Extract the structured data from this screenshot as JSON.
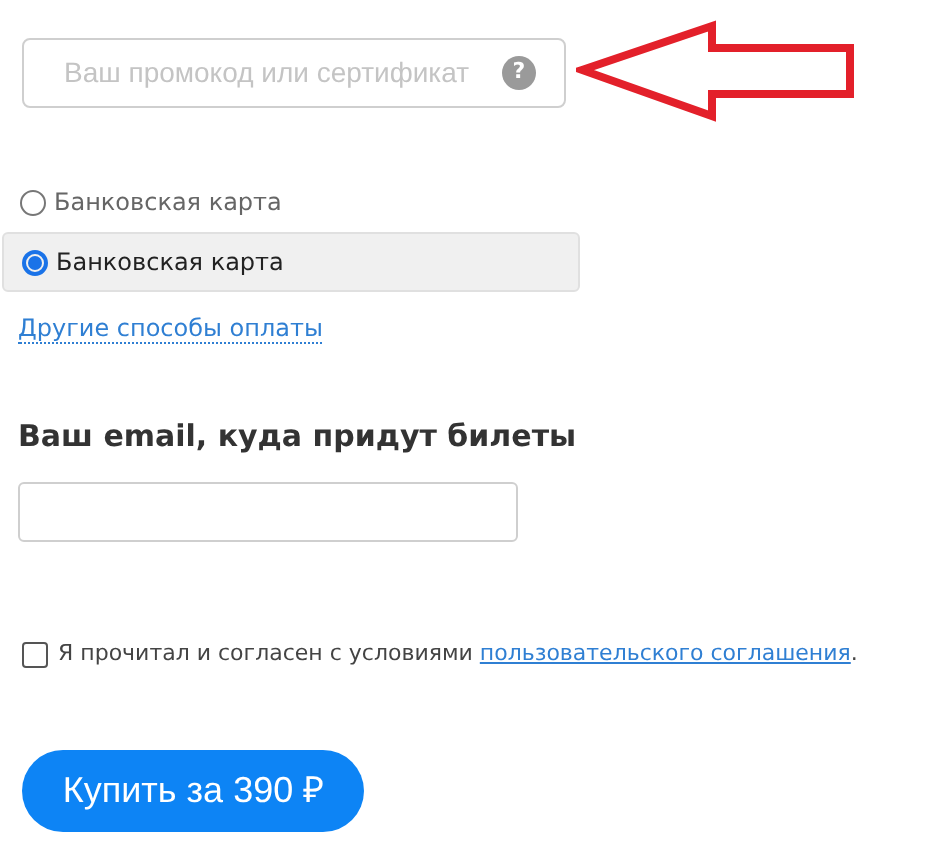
{
  "promo": {
    "placeholder": "Ваш промокод или сертификат",
    "help": "?"
  },
  "payment_methods": [
    {
      "label": "Банковская карта",
      "selected": false
    },
    {
      "label": "Банковская карта",
      "selected": true
    }
  ],
  "other_methods_link": "Другие способы оплаты",
  "email": {
    "heading": "Ваш email, куда придут билеты"
  },
  "agreement": {
    "checked": false,
    "text": "Я прочитал и согласен с условиями ",
    "link": "пользовательского соглашения",
    "end": "."
  },
  "buy_button": "Купить за 390 ₽"
}
